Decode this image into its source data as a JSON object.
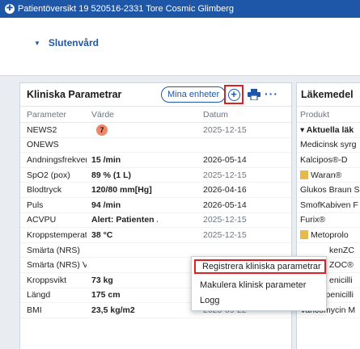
{
  "window": {
    "title": "Patientöversikt 19 520516-2331 Tore Cosmic Glimberg"
  },
  "context": {
    "label": "Slutenvård"
  },
  "left_panel": {
    "title": "Kliniska Parametrar",
    "mina_enheter": "Mina enheter",
    "more": "···",
    "columns": {
      "parameter": "Parameter",
      "value": "Värde",
      "date": "Datum"
    },
    "rows": [
      {
        "parameter": "NEWS2",
        "value": "",
        "badge": "7",
        "info": true,
        "date": "2025-12-15"
      },
      {
        "parameter": "ONEWS",
        "value": "",
        "date": ""
      },
      {
        "parameter": "Andningsfrekvens",
        "value": "15 /min",
        "date": "2026-05-14"
      },
      {
        "parameter": "SpO2 (pox)",
        "value": "89 % (1 L)",
        "date": "2025-12-15"
      },
      {
        "parameter": "Blodtryck",
        "value": "120/80 mm[Hg]",
        "date": "2026-04-16"
      },
      {
        "parameter": "Puls",
        "value": "94 /min",
        "date": "2026-05-14"
      },
      {
        "parameter": "ACVPU",
        "value": "Alert: Patienten ...",
        "date": "2025-12-15"
      },
      {
        "parameter": "Kroppstemperatur",
        "value": "38 °C",
        "date": "2025-12-15"
      },
      {
        "parameter": "Smärta (NRS)",
        "value": "",
        "date": ""
      },
      {
        "parameter": "Smärta (NRS) Vil...",
        "value": "",
        "date": ""
      },
      {
        "parameter": "Kroppsvikt",
        "value": "73 kg",
        "date": ""
      },
      {
        "parameter": "Längd",
        "value": "175 cm",
        "date": "2025-09-22"
      },
      {
        "parameter": "BMI",
        "value": "23,5 kg/m2",
        "info": true,
        "date": "2025-09-22"
      }
    ]
  },
  "right_panel": {
    "title": "Läkemedel",
    "column": "Produkt",
    "rows": [
      {
        "text": "▾ Aktuella läk",
        "bold": true
      },
      {
        "text": "Medicinsk syrg"
      },
      {
        "text": "Kalcipos®-D"
      },
      {
        "text": "Waran®",
        "icon": true
      },
      {
        "text": "Glukos Braun S"
      },
      {
        "text": "SmofKabiven F"
      },
      {
        "text": "Furix®"
      },
      {
        "text": "Metoprolo",
        "icon": true
      },
      {
        "text": "kenZC"
      },
      {
        "text": "ZOC®"
      },
      {
        "text": "enicilli"
      },
      {
        "text": "Bensylpenicilli"
      },
      {
        "text": "Vancomycin M"
      }
    ]
  },
  "context_menu": {
    "items": [
      {
        "label": "Registrera kliniska parametrar"
      },
      {
        "label": "Makulera klinisk parameter"
      },
      {
        "label": "Logg"
      }
    ]
  },
  "colors": {
    "brand": "#1f57a8",
    "highlight": "#e02020",
    "news_badge": "#f0866a"
  }
}
